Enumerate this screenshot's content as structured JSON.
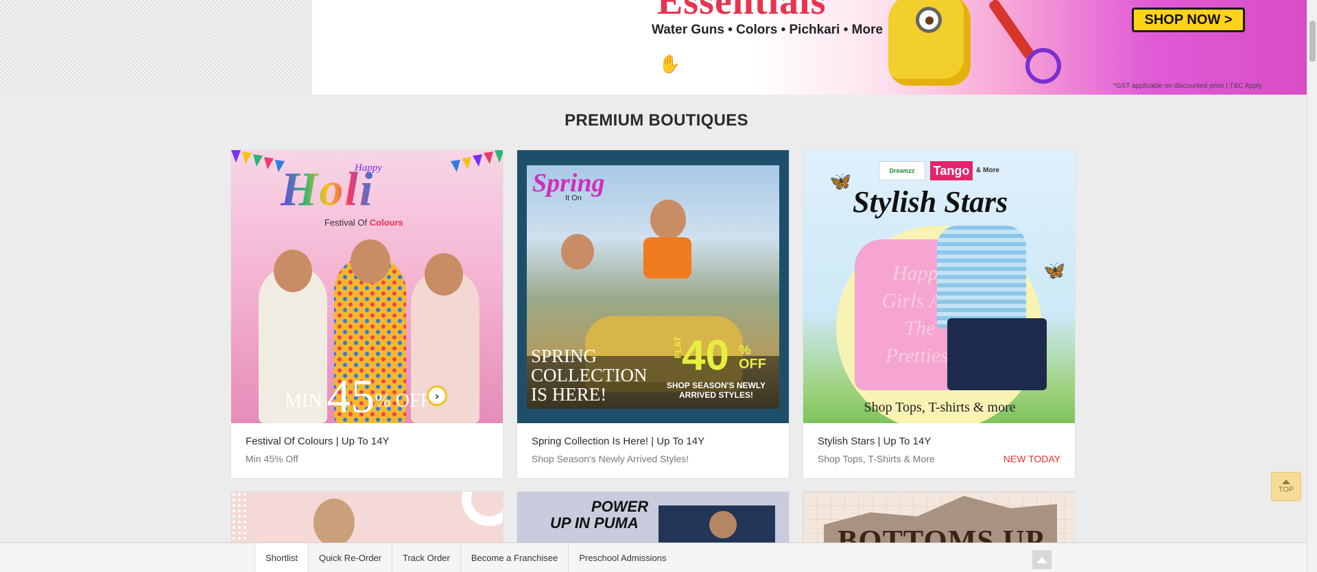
{
  "hero": {
    "title": "Essentials",
    "subtitle": "Water Guns • Colors • Pichkari • More",
    "cta": "SHOP NOW >",
    "disclaimer": "*GST applicable on discounted price | T&C Apply"
  },
  "section_title": "PREMIUM BOUTIQUES",
  "cards": [
    {
      "title": "Festival Of Colours | Up To 14Y",
      "subtitle": "Min 45% Off",
      "badge": "",
      "art": {
        "happy": "Happy",
        "headline": "Holi",
        "tagline_prefix": "Festival Of",
        "tagline_accent": "Colours",
        "min": "MIN",
        "percent": "45",
        "off": "% OFF"
      }
    },
    {
      "title": "Spring Collection Is Here! | Up To 14Y",
      "subtitle": "Shop Season's Newly Arrived Styles!",
      "badge": "",
      "art": {
        "spring": "Spring",
        "on": "It On",
        "collection": "SPRING COLLECTION IS HERE!",
        "flat": "FLAT",
        "percent": "40",
        "pct_off": "% OFF",
        "tag": "SHOP SEASON'S NEWLY ARRIVED STYLES!"
      }
    },
    {
      "title": "Stylish Stars | Up To 14Y",
      "subtitle": "Shop Tops, T-Shirts & More",
      "badge": "NEW TODAY",
      "art": {
        "brand1": "Dreamzz",
        "brand2": "Tango",
        "more": "& More",
        "headline": "Stylish Stars",
        "dress_text": "Happy Girls Are The Prettiest",
        "footer": "Shop Tops, T-shirts & more"
      }
    }
  ],
  "row2": {
    "puma_line1": "POWER",
    "puma_line2": "UP IN PUMA",
    "bottoms": "BOTTOMS UP"
  },
  "top_button": "TOP",
  "bottom_bar": {
    "items": [
      "Shortlist",
      "Quick Re-Order",
      "Track Order",
      "Become a Franchisee",
      "Preschool Admissions"
    ]
  }
}
